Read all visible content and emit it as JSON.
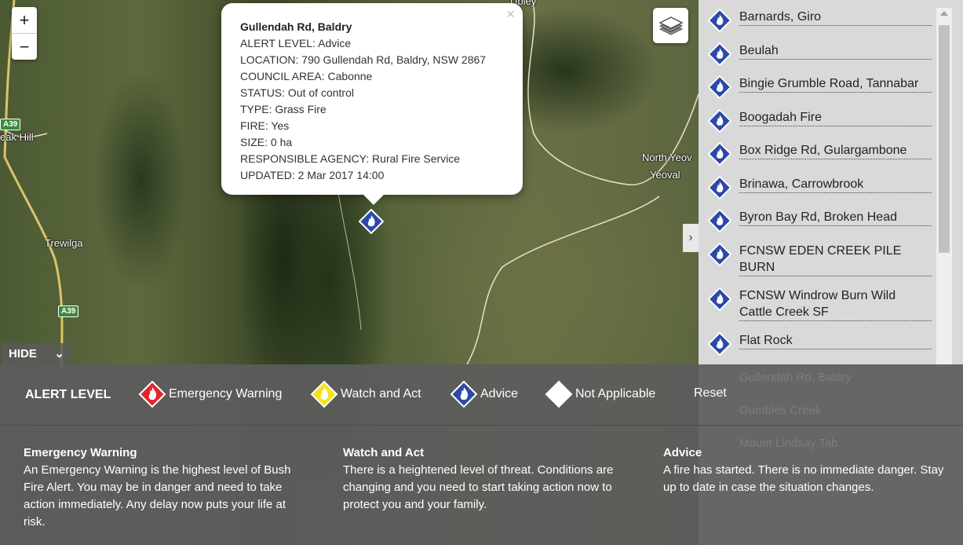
{
  "map": {
    "zoom_in": "+",
    "zoom_out": "−",
    "places": [
      "Trewilga",
      "North Yeov",
      "Yeoval",
      "eak Hill",
      "Ubley"
    ],
    "road_shields": [
      "A39",
      "A39"
    ],
    "layers_icon": "layers-icon",
    "hide_label": "HIDE"
  },
  "popup": {
    "title": "Gullendah Rd, Baldry",
    "close": "×",
    "lines": [
      "ALERT LEVEL: Advice",
      "LOCATION: 790 Gullendah Rd, Baldry, NSW 2867",
      "COUNCIL AREA: Cabonne",
      "STATUS: Out of control",
      "TYPE: Grass Fire",
      "FIRE: Yes",
      "SIZE: 0 ha",
      "RESPONSIBLE AGENCY: Rural Fire Service",
      "UPDATED: 2 Mar 2017 14:00"
    ]
  },
  "sidebar": {
    "items": [
      {
        "label": "Barnards, Giro"
      },
      {
        "label": "Beulah"
      },
      {
        "label": "Bingie Grumble Road, Tannabar"
      },
      {
        "label": "Boogadah Fire"
      },
      {
        "label": "Box Ridge Rd, Gulargambone"
      },
      {
        "label": "Brinawa, Carrowbrook"
      },
      {
        "label": "Byron Bay Rd, Broken Head"
      },
      {
        "label": "FCNSW EDEN CREEK PILE BURN"
      },
      {
        "label": "FCNSW Windrow Burn Wild Cattle Creek SF"
      },
      {
        "label": "Flat Rock"
      }
    ],
    "faded_items": [
      "Gullendah Rd, Baldry",
      "Gumbles Creek",
      "Mount Lindsay Tab"
    ],
    "toggle": "›"
  },
  "legend": {
    "title": "ALERT LEVEL",
    "items": [
      {
        "label": "Emergency Warning",
        "color": "#e32526"
      },
      {
        "label": "Watch and Act",
        "color": "#f3e41a"
      },
      {
        "label": "Advice",
        "color": "#2c49a8"
      },
      {
        "label": "Not Applicable",
        "color": "#ffffff"
      }
    ],
    "reset": "Reset",
    "descriptions": [
      {
        "heading": "Emergency Warning",
        "text": "An Emergency Warning is the highest level of Bush Fire Alert. You may be in danger and need to take action immediately. Any delay now puts your life at risk."
      },
      {
        "heading": "Watch and Act",
        "text": "There is a heightened level of threat. Conditions are changing and you need to start taking action now to protect you and your family."
      },
      {
        "heading": "Advice",
        "text": "A fire has started. There is no immediate danger. Stay up to date in case the situation changes."
      }
    ]
  }
}
